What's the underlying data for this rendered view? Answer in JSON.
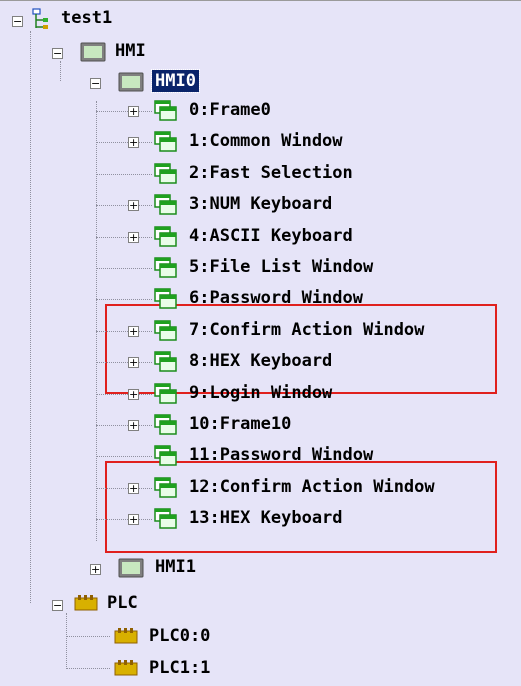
{
  "tree": {
    "root": {
      "label": "test1"
    },
    "hmi": {
      "label": "HMI"
    },
    "hmi0": {
      "label": "HMI0"
    },
    "windows": [
      {
        "label": "0:Frame0"
      },
      {
        "label": "1:Common Window"
      },
      {
        "label": "2:Fast Selection"
      },
      {
        "label": "3:NUM Keyboard"
      },
      {
        "label": "4:ASCII Keyboard"
      },
      {
        "label": "5:File List Window"
      },
      {
        "label": "6:Password Window"
      },
      {
        "label": "7:Confirm Action Window"
      },
      {
        "label": "8:HEX Keyboard"
      },
      {
        "label": "9:Login Window"
      },
      {
        "label": "10:Frame10"
      },
      {
        "label": "11:Password Window"
      },
      {
        "label": "12:Confirm Action Window"
      },
      {
        "label": "13:HEX Keyboard"
      }
    ],
    "hmi1": {
      "label": "HMI1"
    },
    "plc": {
      "label": "PLC"
    },
    "plc_items": [
      {
        "label": "PLC0:0"
      },
      {
        "label": "PLC1:1"
      }
    ]
  },
  "colors": {
    "background": "#e6e4f8",
    "selection": "#0a246a",
    "highlight_box": "#e0201e",
    "window_icon": "#1fa01f",
    "plc_icon": "#c8a000"
  }
}
